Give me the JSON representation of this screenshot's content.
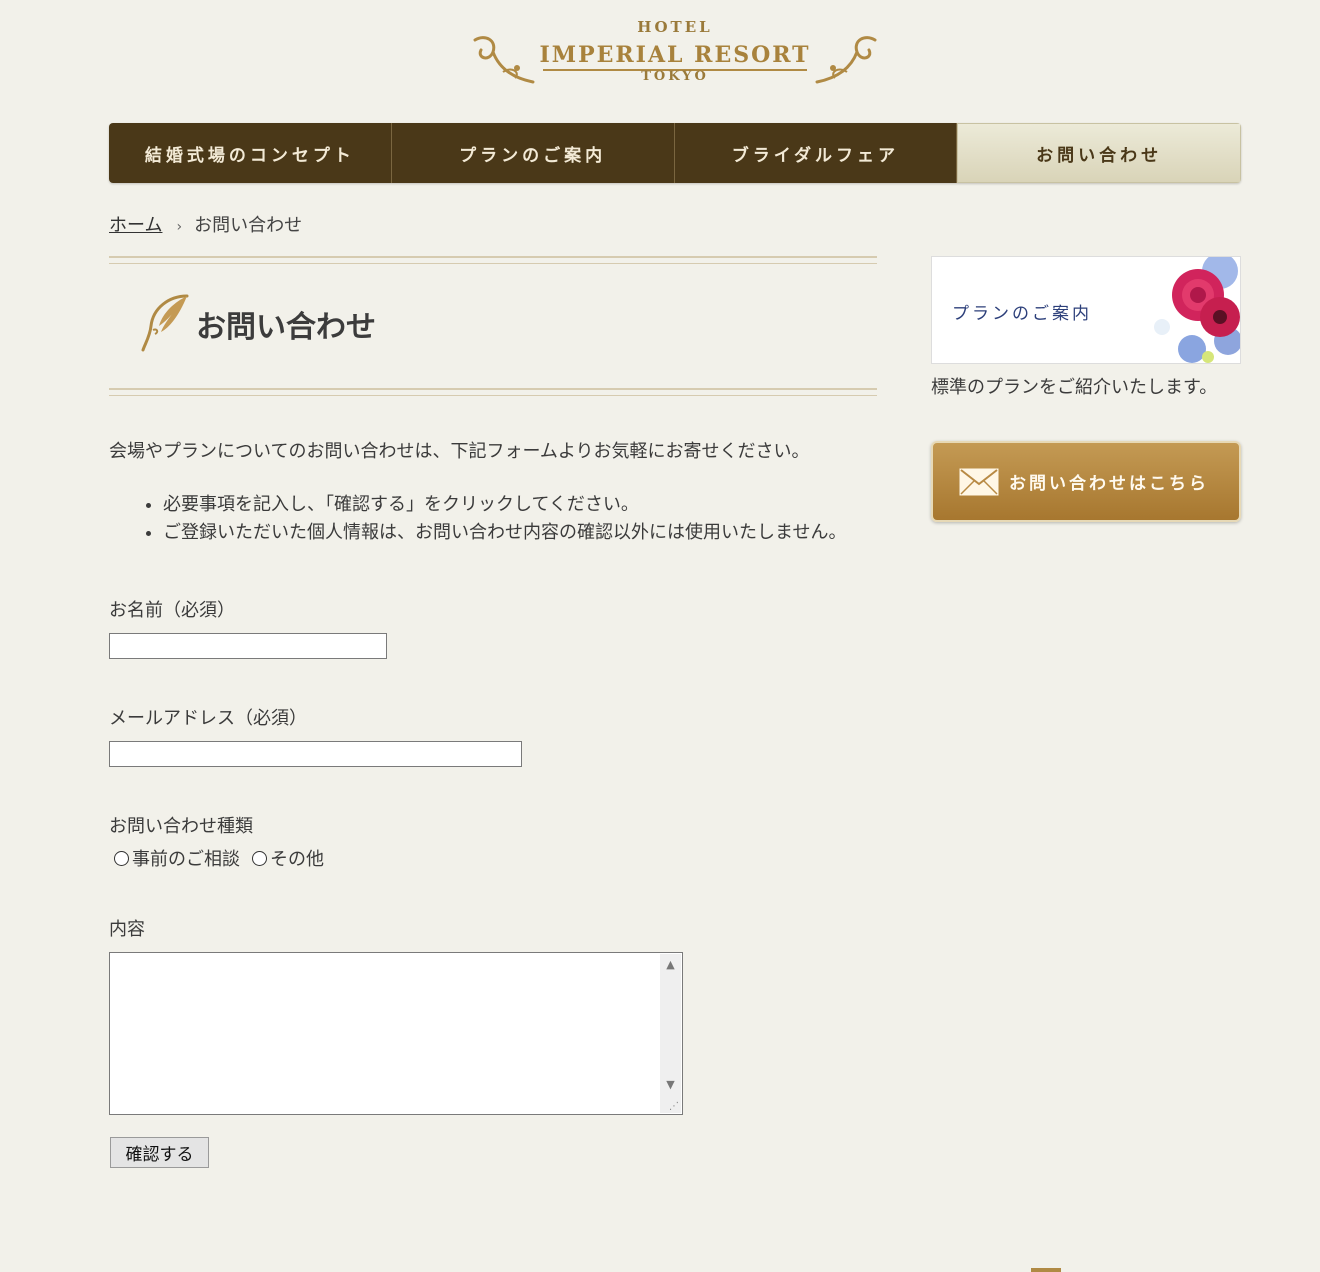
{
  "logo": {
    "hotel": "HOTEL",
    "name": "IMPERIAL RESORT",
    "city": "TOKYO"
  },
  "nav": {
    "items": [
      {
        "label": "結婚式場のコンセプト"
      },
      {
        "label": "プランのご案内"
      },
      {
        "label": "ブライダルフェア"
      },
      {
        "label": "お問い合わせ"
      }
    ],
    "active_index": 3
  },
  "breadcrumb": {
    "home": "ホーム",
    "separator": "›",
    "current": "お問い合わせ"
  },
  "page": {
    "title": "お問い合わせ",
    "intro": "会場やプランについてのお問い合わせは、下記フォームよりお気軽にお寄せください。",
    "notes": [
      "必要事項を記入し、「確認する」をクリックしてください。",
      "ご登録いただいた個人情報は、お問い合わせ内容の確認以外には使用いたしません。"
    ]
  },
  "form": {
    "name_label": "お名前（必須）",
    "name_value": "",
    "email_label": "メールアドレス（必須）",
    "email_value": "",
    "type_label": "お問い合わせ種類",
    "type_options": [
      "事前のご相談",
      "その他"
    ],
    "content_label": "内容",
    "content_value": "",
    "submit_label": "確認する"
  },
  "sidebar": {
    "plan_banner_text": "プランのご案内",
    "plan_caption": "標準のプランをご紹介いたします。",
    "contact_button": "お問い合わせはこちら"
  },
  "colors": {
    "background": "#f2f1ea",
    "nav_dark": "#4a3818",
    "nav_active": "#e3dfc6",
    "gold": "#b08a44"
  }
}
